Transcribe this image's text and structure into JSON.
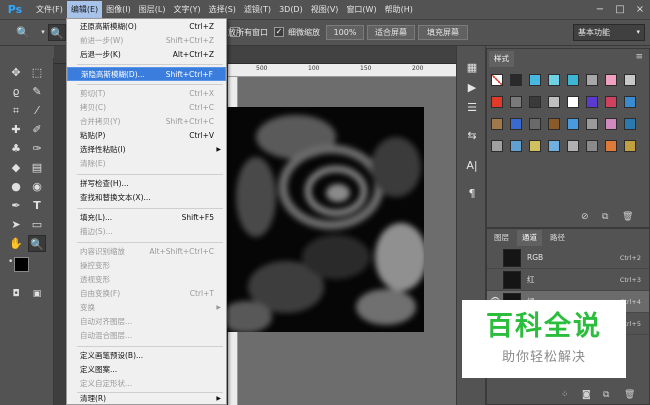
{
  "menubar": {
    "logo": "Ps",
    "items": [
      "文件(F)",
      "编辑(E)",
      "图像(I)",
      "图层(L)",
      "文字(Y)",
      "选择(S)",
      "滤镜(T)",
      "3D(D)",
      "视图(V)",
      "窗口(W)",
      "帮助(H)"
    ],
    "window_controls": [
      "−",
      "□",
      "×"
    ]
  },
  "options": {
    "all_windows_label": "放所有窗口",
    "scrubby_zoom_label": "细微缩放",
    "zoom_100": "100%",
    "fit_screen": "适合屏幕",
    "fill_screen": "填充屏幕",
    "workspace": "基本功能"
  },
  "ruler": {
    "ticks": [
      "500",
      "100",
      "150",
      "200"
    ]
  },
  "edit_menu": {
    "items": [
      {
        "label": "还原高斯模糊(O)",
        "shortcut": "Ctrl+Z",
        "disabled": false
      },
      {
        "label": "前进一步(W)",
        "shortcut": "Shift+Ctrl+Z",
        "disabled": true
      },
      {
        "label": "后退一步(K)",
        "shortcut": "Alt+Ctrl+Z",
        "disabled": false
      },
      {
        "label": "渐隐高斯模糊(D)...",
        "shortcut": "Shift+Ctrl+F",
        "disabled": false,
        "highlight": true
      },
      {
        "label": "剪切(T)",
        "shortcut": "Ctrl+X",
        "disabled": true
      },
      {
        "label": "拷贝(C)",
        "shortcut": "Ctrl+C",
        "disabled": true
      },
      {
        "label": "合并拷贝(Y)",
        "shortcut": "Shift+Ctrl+C",
        "disabled": true
      },
      {
        "label": "粘贴(P)",
        "shortcut": "Ctrl+V",
        "disabled": false
      },
      {
        "label": "选择性粘贴(I)",
        "shortcut": "",
        "disabled": false,
        "submenu": true
      },
      {
        "label": "清除(E)",
        "shortcut": "",
        "disabled": true
      },
      {
        "label": "拼写检查(H)...",
        "shortcut": "",
        "disabled": false
      },
      {
        "label": "查找和替换文本(X)...",
        "shortcut": "",
        "disabled": false
      },
      {
        "label": "填充(L)...",
        "shortcut": "Shift+F5",
        "disabled": false
      },
      {
        "label": "描边(S)...",
        "shortcut": "",
        "disabled": true
      },
      {
        "label": "内容识别缩放",
        "shortcut": "Alt+Shift+Ctrl+C",
        "disabled": true
      },
      {
        "label": "操控变形",
        "shortcut": "",
        "disabled": true
      },
      {
        "label": "透视变形",
        "shortcut": "",
        "disabled": true
      },
      {
        "label": "自由变换(F)",
        "shortcut": "Ctrl+T",
        "disabled": true
      },
      {
        "label": "变换",
        "shortcut": "",
        "disabled": true,
        "submenu": true
      },
      {
        "label": "自动对齐图层...",
        "shortcut": "",
        "disabled": true
      },
      {
        "label": "自动混合图层...",
        "shortcut": "",
        "disabled": true
      },
      {
        "label": "定义画笔预设(B)...",
        "shortcut": "",
        "disabled": false
      },
      {
        "label": "定义图案...",
        "shortcut": "",
        "disabled": false
      },
      {
        "label": "定义自定形状...",
        "shortcut": "",
        "disabled": true
      },
      {
        "label": "清理(R)",
        "shortcut": "",
        "disabled": false,
        "submenu": true
      }
    ]
  },
  "styles_panel": {
    "tab": "样式",
    "swatch_colors": [
      "#ffffff",
      "#2a2a2a",
      "#47b8e0",
      "#6fd3e6",
      "#3fb6d4",
      "#a8a8a8",
      "#f0a0c0",
      "#c8c8c8",
      "#e03a2a",
      "#7a7a7a",
      "#3a3a3a",
      "#c0c0c0",
      "#ffffff",
      "#5a3ad0",
      "#d04060",
      "#3a8ad0",
      "#a07a4a",
      "#3a6ad0",
      "#6a6a6a",
      "#8a5a2a",
      "#4a9ae0",
      "#9a9a9a",
      "#d08ac0",
      "#2a7ab0",
      "#a0a0a0",
      "#60a0d0",
      "#d0c060",
      "#70b0e0",
      "#b0b0b0",
      "#8a8a8a",
      "#e07a3a",
      "#c0a040"
    ]
  },
  "channels_panel": {
    "tabs": [
      "图层",
      "通道",
      "路径"
    ],
    "channels": [
      {
        "name": "RGB",
        "shortcut": "Ctrl+2"
      },
      {
        "name": "红",
        "shortcut": "Ctrl+3"
      },
      {
        "name": "绿",
        "shortcut": "Ctrl+4"
      },
      {
        "name": "蓝",
        "shortcut": "Ctrl+5"
      }
    ]
  },
  "watermark": {
    "title": "百科全说",
    "subtitle": "助你轻松解决"
  }
}
